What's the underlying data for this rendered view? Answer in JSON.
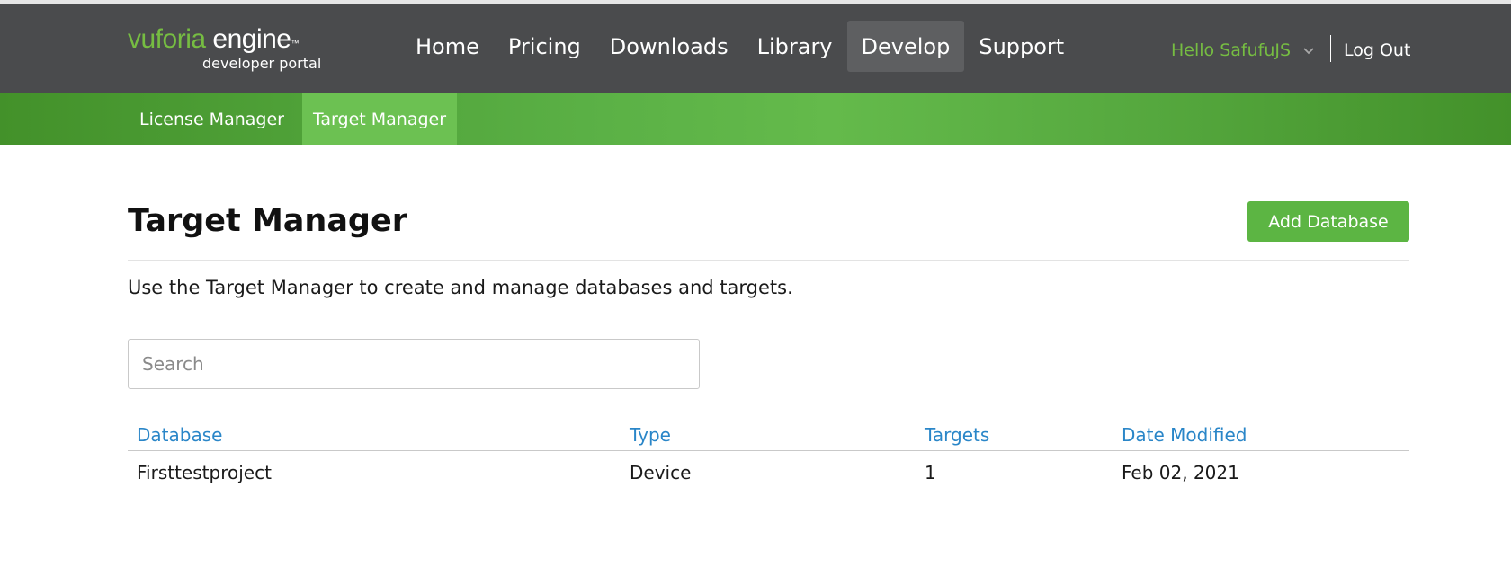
{
  "logo": {
    "brand": "vuforia",
    "product": "engine",
    "tm": "™",
    "sub": "developer portal"
  },
  "nav": [
    {
      "label": "Home",
      "active": false
    },
    {
      "label": "Pricing",
      "active": false
    },
    {
      "label": "Downloads",
      "active": false
    },
    {
      "label": "Library",
      "active": false
    },
    {
      "label": "Develop",
      "active": true
    },
    {
      "label": "Support",
      "active": false
    }
  ],
  "user": {
    "greeting": "Hello SafufuJS",
    "logout": "Log Out"
  },
  "subnav": [
    {
      "label": "License Manager",
      "active": false
    },
    {
      "label": "Target Manager",
      "active": true
    }
  ],
  "page": {
    "title": "Target Manager",
    "add_button": "Add Database",
    "description": "Use the Target Manager to create and manage databases and targets."
  },
  "search": {
    "placeholder": "Search",
    "value": ""
  },
  "table": {
    "headers": [
      "Database",
      "Type",
      "Targets",
      "Date Modified"
    ],
    "rows": [
      [
        "Firsttestproject",
        "Device",
        "1",
        "Feb 02, 2021"
      ]
    ]
  },
  "colors": {
    "header_bg": "#4a4b4d",
    "accent_green": "#76bd42",
    "button_green": "#5cb543",
    "link_blue": "#2a86c8"
  }
}
